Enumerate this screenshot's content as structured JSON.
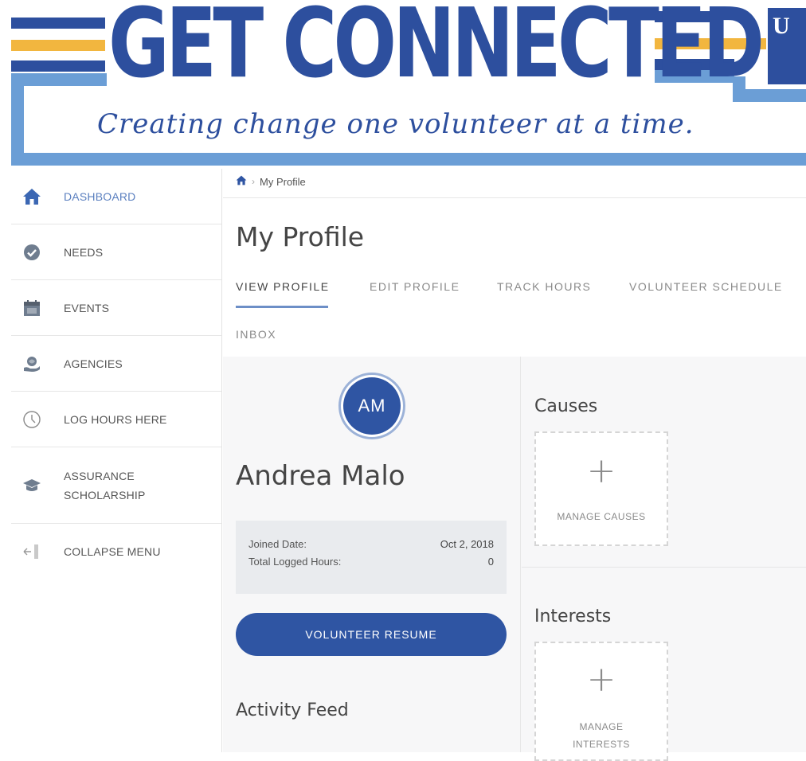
{
  "banner": {
    "title": "GET CONNECTED",
    "tagline": "Creating change one volunteer at a time.",
    "corner_text": "U",
    "colors": {
      "navy": "#2d4f9e",
      "gold": "#f2b63f",
      "light_blue": "#6b9ed6"
    }
  },
  "sidebar": {
    "items": [
      {
        "label": "DASHBOARD",
        "icon": "home-icon",
        "active": true
      },
      {
        "label": "NEEDS",
        "icon": "check-circle-icon"
      },
      {
        "label": "EVENTS",
        "icon": "calendar-icon"
      },
      {
        "label": "AGENCIES",
        "icon": "hand-globe-icon"
      },
      {
        "label": "LOG HOURS HERE",
        "icon": "clock-icon"
      },
      {
        "label": "ASSURANCE SCHOLARSHIP",
        "icon": "graduation-cap-icon"
      },
      {
        "label": "COLLAPSE MENU",
        "icon": "collapse-arrow-icon"
      }
    ]
  },
  "breadcrumb": {
    "home_icon": "home-icon",
    "current": "My Profile"
  },
  "page": {
    "title": "My Profile"
  },
  "tabs": [
    {
      "label": "VIEW PROFILE",
      "active": true
    },
    {
      "label": "EDIT PROFILE"
    },
    {
      "label": "TRACK HOURS"
    },
    {
      "label": "VOLUNTEER SCHEDULE"
    },
    {
      "label": "INBOX"
    }
  ],
  "profile": {
    "initials": "AM",
    "name": "Andrea Malo",
    "stats": {
      "joined_label": "Joined Date:",
      "joined_value": "Oct 2, 2018",
      "hours_label": "Total Logged Hours:",
      "hours_value": "0"
    },
    "resume_button": "VOLUNTEER RESUME",
    "activity_heading": "Activity Feed"
  },
  "causes": {
    "heading": "Causes",
    "card_label": "MANAGE CAUSES"
  },
  "interests": {
    "heading": "Interests",
    "card_label": "MANAGE INTERESTS"
  },
  "colors": {
    "accent": "#2f55a3",
    "active_nav": "#5a7fbf",
    "tab_underline": "#6d8fc7"
  }
}
